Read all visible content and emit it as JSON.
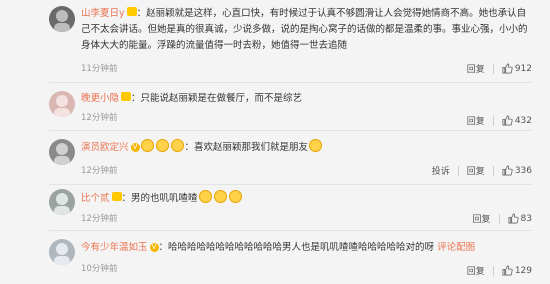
{
  "comments": [
    {
      "name": "山李夏日y",
      "badge": "crown",
      "text_lines": [
        "：赵丽颖就是这样，心直口快，有时候过于认真不够圆滑让人会觉得她情商不高。她也承认自",
        "己不太会讲话。但她是真的很真诚，少说多做，说的是掏心窝子的话做的都是温柔的事。事业心强，小小的",
        "身体大大的能量。浮躁的流量值得一时去粉，她值得一世去追随"
      ],
      "time": "11分钟前",
      "reply_label": "回复",
      "likes": "912",
      "avatar_color": "#6a6a6a"
    },
    {
      "name": "晚更小隐",
      "badge": "crown",
      "text_lines": [
        "：只能说赵丽颖是在做餐厅，而不是综艺"
      ],
      "time": "12分钟前",
      "reply_label": "回复",
      "likes": "432",
      "avatar_color": "#d9b6b2"
    },
    {
      "name": "演员欧定兴",
      "badge": "v",
      "text_lines": [
        "：喜欢赵丽颖那我们就是朋友"
      ],
      "time": "12分钟前",
      "report_label": "投诉",
      "reply_label": "回复",
      "likes": "336",
      "avatar_color": "#8a8a8a"
    },
    {
      "name": "比个贰",
      "badge": "crown",
      "text_lines": [
        "：男的也叽叽喳喳"
      ],
      "time": "12分钟前",
      "reply_label": "回复",
      "likes": "83",
      "avatar_color": "#9aa3a0"
    },
    {
      "name": "今有少年温如玉",
      "badge": "v",
      "text_lines": [
        "：哈哈哈哈哈哈哈哈哈哈哈哈男人也是叽叽喳喳哈哈哈哈哈对的呀"
      ],
      "link_text": "评论配图",
      "time": "10分钟前",
      "reply_label": "回复",
      "likes": "129",
      "avatar_color": "#b0b7bd"
    }
  ]
}
